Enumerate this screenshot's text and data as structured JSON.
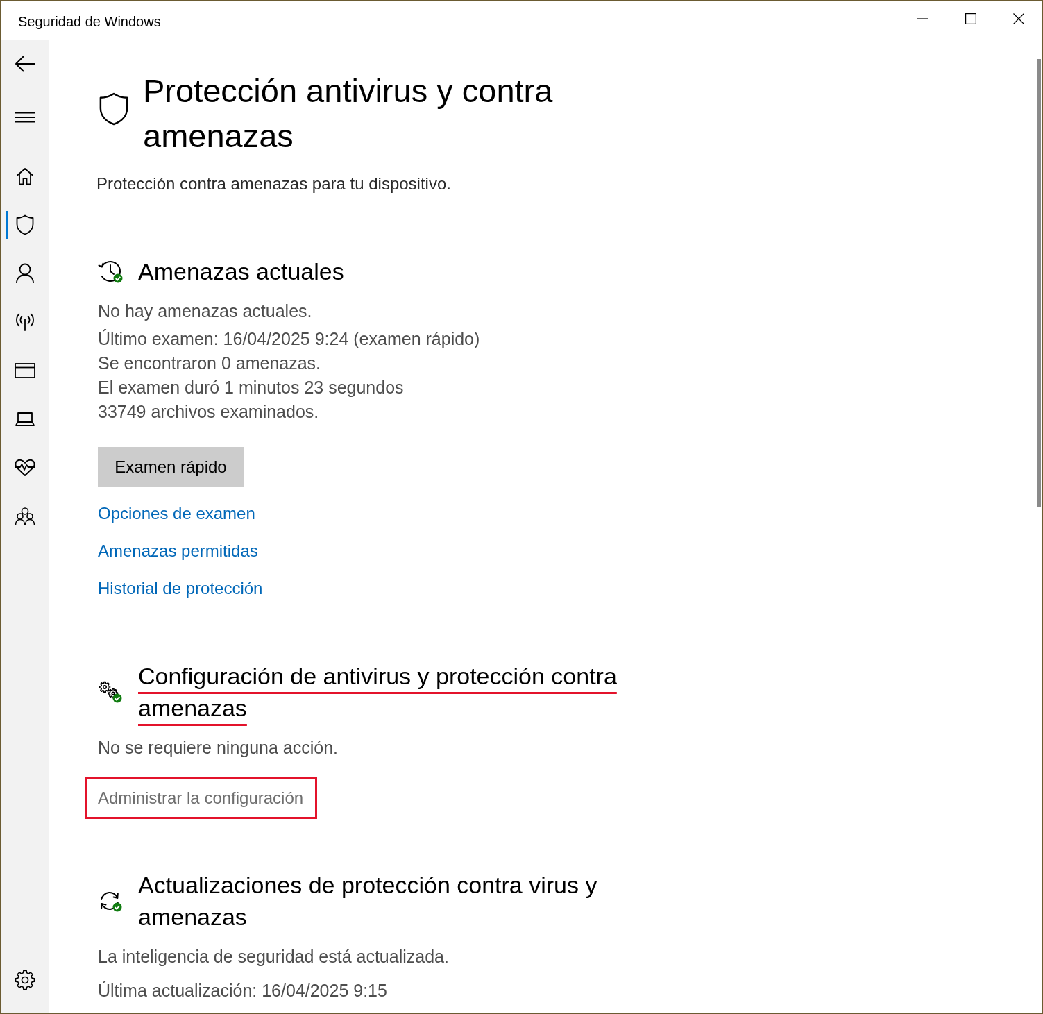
{
  "window": {
    "title": "Seguridad de Windows"
  },
  "sidebar": {
    "items": [
      {
        "selected": false
      },
      {
        "selected": true
      },
      {
        "selected": false
      },
      {
        "selected": false
      },
      {
        "selected": false
      },
      {
        "selected": false
      },
      {
        "selected": false
      },
      {
        "selected": false
      }
    ]
  },
  "page": {
    "title": "Protección antivirus y contra amenazas",
    "subtitle": "Protección contra amenazas para tu dispositivo."
  },
  "sections": [
    {
      "heading": "Amenazas actuales",
      "underlined": false,
      "status": "No hay amenazas actuales.",
      "details": [
        "Último examen: 16/04/2025 9:24 (examen rápido)",
        "Se encontraron 0 amenazas.",
        "El examen duró 1 minutos 23 segundos",
        "33749 archivos examinados."
      ],
      "button": "Examen rápido",
      "links": [
        {
          "label": "Opciones de examen",
          "hovered": false,
          "boxed": false
        },
        {
          "label": "Amenazas permitidas",
          "hovered": false,
          "boxed": false
        },
        {
          "label": "Historial de protección",
          "hovered": false,
          "boxed": false
        }
      ]
    },
    {
      "heading": "Configuración de antivirus y protección contra amenazas",
      "underlined": true,
      "status": "No se requiere ninguna acción.",
      "links": [
        {
          "label": "Administrar la configuración",
          "hovered": true,
          "boxed": true
        }
      ]
    },
    {
      "heading": "Actualizaciones de protección contra virus y amenazas",
      "underlined": false,
      "status": "La inteligencia de seguridad está actualizada.",
      "details": [
        "Última actualización: 16/04/2025 9:15"
      ]
    }
  ]
}
